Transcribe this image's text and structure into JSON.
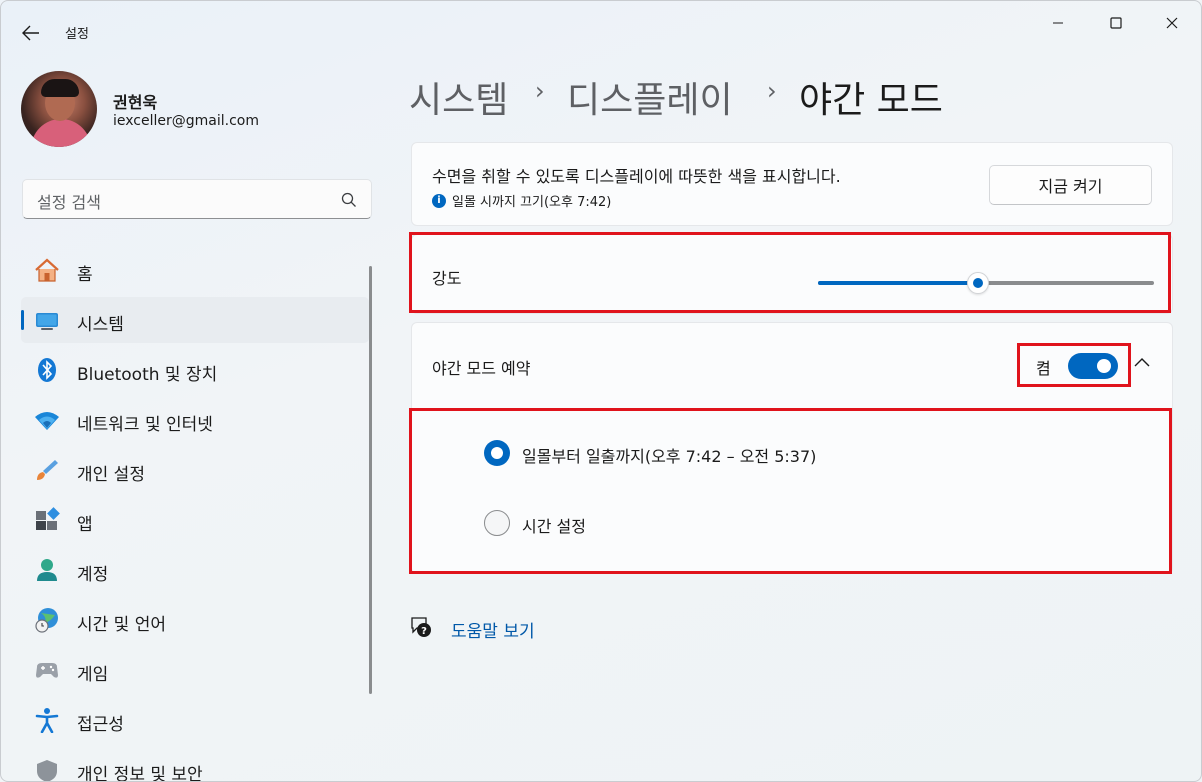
{
  "app": {
    "title": "설정"
  },
  "profile": {
    "name": "권현욱",
    "email": "iexceller@gmail.com"
  },
  "search": {
    "placeholder": "설정 검색"
  },
  "sidebar": {
    "items": [
      {
        "label": "홈",
        "icon": "home-icon"
      },
      {
        "label": "시스템",
        "icon": "system-icon",
        "selected": true
      },
      {
        "label": "Bluetooth 및 장치",
        "icon": "bluetooth-icon"
      },
      {
        "label": "네트워크 및 인터넷",
        "icon": "wifi-icon"
      },
      {
        "label": "개인 설정",
        "icon": "brush-icon"
      },
      {
        "label": "앱",
        "icon": "apps-icon"
      },
      {
        "label": "계정",
        "icon": "account-icon"
      },
      {
        "label": "시간 및 언어",
        "icon": "globe-clock-icon"
      },
      {
        "label": "게임",
        "icon": "gamepad-icon"
      },
      {
        "label": "접근성",
        "icon": "accessibility-icon"
      },
      {
        "label": "개인 정보 및 보안",
        "icon": "shield-icon"
      }
    ]
  },
  "breadcrumb": {
    "items": [
      "시스템",
      "디스플레이",
      "야간 모드"
    ],
    "separator": "›"
  },
  "night_light": {
    "description": "수면을 취할 수 있도록 디스플레이에 따뜻한 색을 표시합니다.",
    "status": "일몰 시까지 끄기(오후 7:42)",
    "turn_on_button": "지금 켜기",
    "strength_label": "강도",
    "strength_value": 0.5,
    "schedule_label": "야간 모드 예약",
    "schedule_toggle_label": "켬",
    "schedule_on": true,
    "options": [
      {
        "label": "일몰부터 일출까지(오후 7:42 – 오전 5:37)",
        "checked": true
      },
      {
        "label": "시간 설정",
        "checked": false
      }
    ]
  },
  "help": {
    "link": "도움말 보기"
  },
  "colors": {
    "accent": "#0067c0",
    "highlight": "#e0131c"
  }
}
